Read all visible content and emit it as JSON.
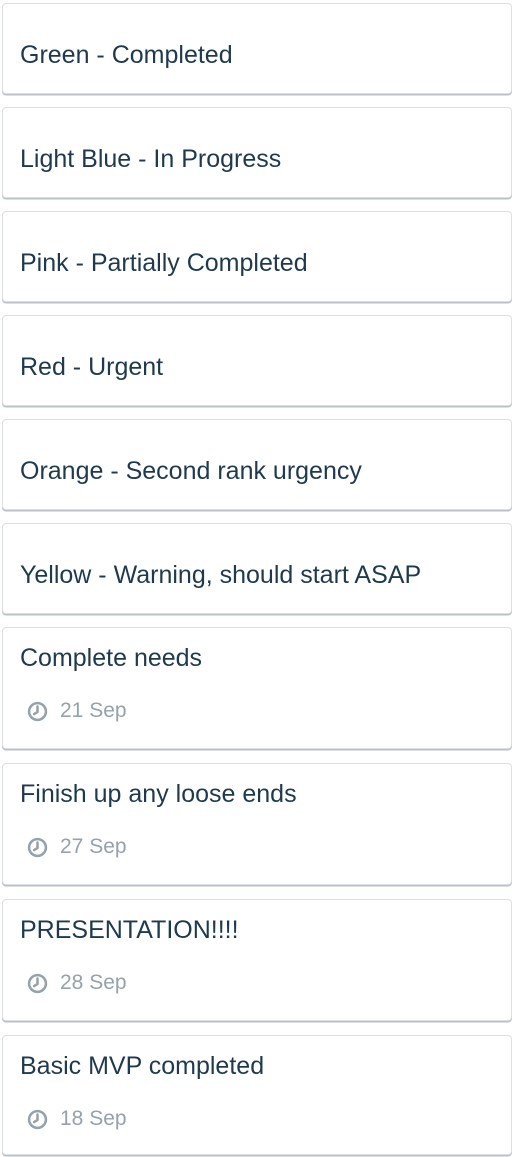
{
  "cards": [
    {
      "title": "Green - Completed"
    },
    {
      "title": "Light Blue - In Progress"
    },
    {
      "title": "Pink - Partially Completed"
    },
    {
      "title": "Red - Urgent"
    },
    {
      "title": "Orange - Second rank urgency"
    },
    {
      "title": "Yellow - Warning, should start ASAP"
    },
    {
      "title": "Complete needs",
      "due": "21 Sep",
      "icon": "clock-icon"
    },
    {
      "title": "Finish up any loose ends",
      "due": "27 Sep",
      "icon": "clock-icon"
    },
    {
      "title": "PRESENTATION!!!!",
      "due": "28 Sep",
      "icon": "clock-icon"
    },
    {
      "title": "Basic MVP completed",
      "due": "18 Sep",
      "icon": "clock-icon"
    }
  ]
}
